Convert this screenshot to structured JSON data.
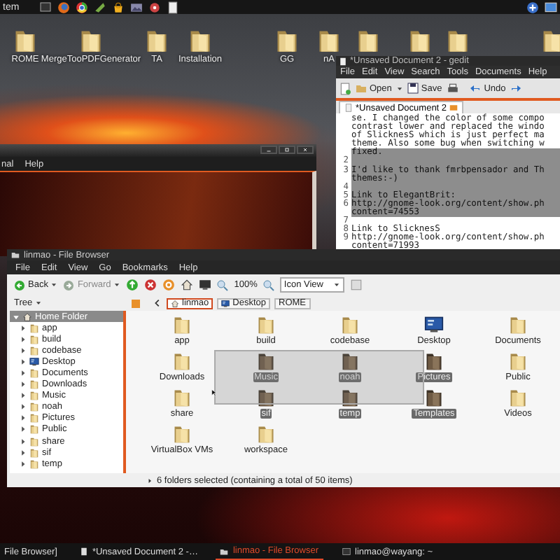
{
  "top_panel": {
    "menu": "tem"
  },
  "desktop_icons": [
    {
      "label": "ROME"
    },
    {
      "label": "MergeTooPDFGenerator"
    },
    {
      "label": "TA"
    },
    {
      "label": "Installation"
    },
    {
      "label": "GG"
    },
    {
      "label": "nA"
    }
  ],
  "terminal": {
    "menus": [
      "nal",
      "Help"
    ]
  },
  "gedit": {
    "title": "*Unsaved Document 2 - gedit",
    "menus": [
      "File",
      "Edit",
      "View",
      "Search",
      "Tools",
      "Documents",
      "Help"
    ],
    "toolbar": [
      "Open",
      "Save",
      "Undo"
    ],
    "tab": "*Unsaved Document 2",
    "lines": [
      {
        "text": "se. I changed the color of some compo",
        "selected": false
      },
      {
        "text": "contrast lower and replaced the windo",
        "selected": false
      },
      {
        "text": "of SlicknesS which is just perfect ma",
        "selected": false
      },
      {
        "text": "theme. Also some bug when switching w",
        "selected": false
      },
      {
        "text": "fixed.",
        "selected": true
      },
      {
        "number": "2",
        "selected": true
      },
      {
        "number": "3",
        "text": "I'd like to thank fmrbpensador and Th",
        "selected": true
      },
      {
        "text": "themes:-)",
        "selected": true
      },
      {
        "number": "4",
        "selected": true
      },
      {
        "number": "5",
        "text": "Link to ElegantBrit:",
        "selected": true
      },
      {
        "number": "6",
        "text": "http://gnome-look.org/content/show.ph",
        "selected": true
      },
      {
        "text": "content=74553",
        "selected": true
      },
      {
        "number": "7",
        "selected": false
      },
      {
        "number": "8",
        "text": "Link to SlicknesS",
        "selected": false
      },
      {
        "number": "9",
        "text": "http://gnome-look.org/content/show.ph",
        "selected": false
      },
      {
        "text": "content=71993",
        "selected": false
      }
    ]
  },
  "file_browser": {
    "title": "linmao - File Browser",
    "menus": [
      "File",
      "Edit",
      "View",
      "Go",
      "Bookmarks",
      "Help"
    ],
    "nav": [
      {
        "label": "Back",
        "disabled": false
      },
      {
        "label": "Forward",
        "disabled": true
      }
    ],
    "zoom": "100%",
    "view": "Icon View",
    "side_pane": "Tree",
    "path": [
      {
        "label": "linmao",
        "selected": true,
        "kind": "home"
      },
      {
        "label": "Desktop",
        "selected": false,
        "kind": "desktop"
      },
      {
        "label": "ROME",
        "selected": false,
        "kind": "plain"
      }
    ],
    "tree": [
      {
        "label": "Home Folder",
        "kind": "home",
        "expanded": true,
        "children": [
          {
            "label": "app",
            "kind": "folder",
            "expanded": false
          },
          {
            "label": "build",
            "kind": "folder",
            "expanded": false
          },
          {
            "label": "codebase",
            "kind": "folder",
            "expanded": false
          },
          {
            "label": "Desktop",
            "kind": "desktop",
            "expanded": false
          },
          {
            "label": "Documents",
            "kind": "folder",
            "expanded": false
          },
          {
            "label": "Downloads",
            "kind": "folder",
            "expanded": false
          },
          {
            "label": "Music",
            "kind": "folder",
            "expanded": false
          },
          {
            "label": "noah",
            "kind": "folder",
            "expanded": false
          },
          {
            "label": "Pictures",
            "kind": "folder",
            "expanded": false
          },
          {
            "label": "Public",
            "kind": "folder",
            "expanded": false
          },
          {
            "label": "share",
            "kind": "folder",
            "expanded": false
          },
          {
            "label": "sif",
            "kind": "folder",
            "expanded": false
          },
          {
            "label": "temp",
            "kind": "folder",
            "expanded": false
          }
        ]
      }
    ],
    "items": [
      {
        "label": "app",
        "kind": "folder",
        "selected": false
      },
      {
        "label": "build",
        "kind": "folder",
        "selected": false
      },
      {
        "label": "codebase",
        "kind": "folder",
        "selected": false
      },
      {
        "label": "Desktop",
        "kind": "desktop",
        "selected": false
      },
      {
        "label": "Documents",
        "kind": "folder",
        "selected": false
      },
      {
        "label": "Downloads",
        "kind": "folder",
        "selected": false
      },
      {
        "label": "Music",
        "kind": "folder",
        "selected": true
      },
      {
        "label": "noah",
        "kind": "folder",
        "selected": true
      },
      {
        "label": "Pictures",
        "kind": "folder",
        "selected": true
      },
      {
        "label": "Public",
        "kind": "folder",
        "selected": false
      },
      {
        "label": "share",
        "kind": "folder",
        "selected": false
      },
      {
        "label": "sif",
        "kind": "folder",
        "selected": true
      },
      {
        "label": "temp",
        "kind": "folder",
        "selected": true
      },
      {
        "label": "Templates",
        "kind": "folder",
        "selected": true
      },
      {
        "label": "Videos",
        "kind": "folder",
        "selected": false
      },
      {
        "label": "VirtualBox VMs",
        "kind": "folder",
        "selected": false
      },
      {
        "label": "workspace",
        "kind": "folder",
        "selected": false
      }
    ],
    "status": "6 folders selected (containing a total of 50 items)"
  },
  "taskbar": [
    {
      "label": "File Browser]",
      "kind": "none",
      "active": false
    },
    {
      "label": "*Unsaved Document 2 -…",
      "kind": "document",
      "active": false
    },
    {
      "label": "linmao - File Browser",
      "kind": "folder",
      "active": true
    },
    {
      "label": "linmao@wayang: ~",
      "kind": "terminal",
      "active": false
    }
  ]
}
